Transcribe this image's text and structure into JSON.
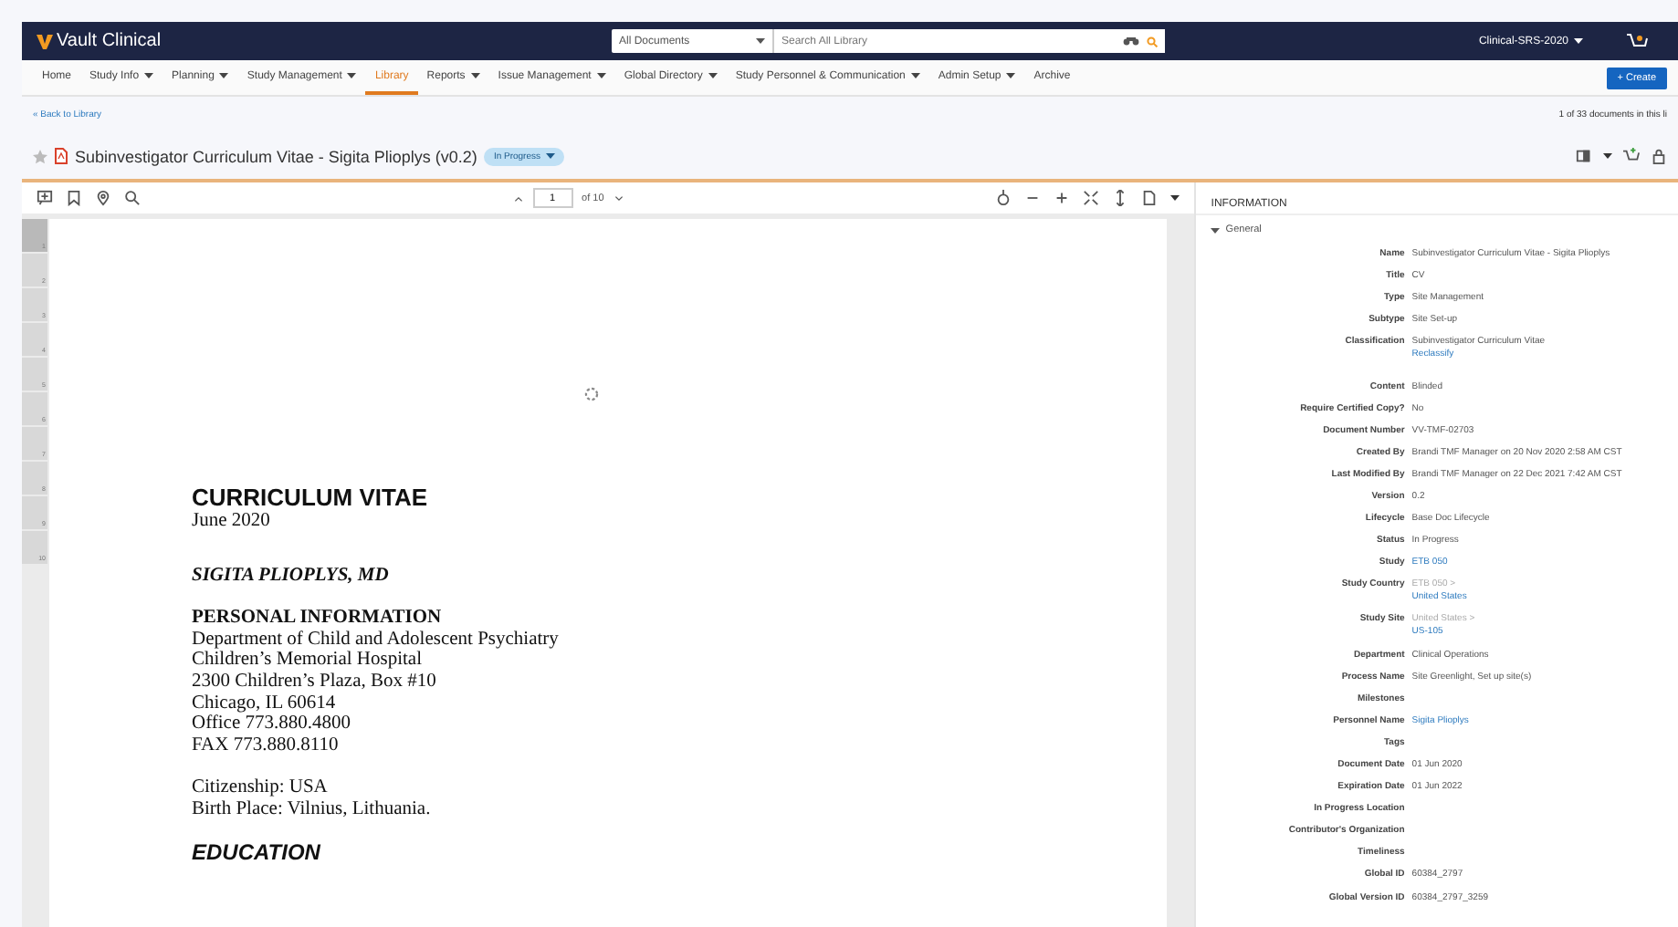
{
  "header": {
    "logo": "Vault Clinical",
    "scope_select": "All Documents",
    "search": {
      "placeholder": "Search All Library"
    },
    "vault_menu": "Clinical-SRS-2020"
  },
  "nav": {
    "items": [
      {
        "label": "Home",
        "has_menu": false,
        "selected": false
      },
      {
        "label": "Study Info",
        "has_menu": true,
        "selected": false
      },
      {
        "label": "Planning",
        "has_menu": true,
        "selected": false
      },
      {
        "label": "Study Management",
        "has_menu": true,
        "selected": false
      },
      {
        "label": "Library",
        "has_menu": false,
        "selected": true
      },
      {
        "label": "Reports",
        "has_menu": true,
        "selected": false
      },
      {
        "label": "Issue Management",
        "has_menu": true,
        "selected": false
      },
      {
        "label": "Global Directory",
        "has_menu": true,
        "selected": false
      },
      {
        "label": "Study Personnel & Communication",
        "has_menu": true,
        "selected": false
      },
      {
        "label": "Admin Setup",
        "has_menu": true,
        "selected": false
      },
      {
        "label": "Archive",
        "has_menu": false,
        "selected": false
      }
    ],
    "create_button": "+ Create"
  },
  "back_link": "« Back to Library",
  "doc_counter": "1 of 33 documents in this li",
  "document": {
    "title": "Subinvestigator Curriculum Vitae - Sigita Plioplys (v0.2)",
    "favorite": false,
    "status": "In Progress"
  },
  "viewer": {
    "page_input": "1",
    "page_total": "of 10",
    "pages": [
      {
        "number": "1",
        "selected": true
      },
      {
        "number": "2",
        "selected": false
      },
      {
        "number": "3",
        "selected": false
      },
      {
        "number": "4",
        "selected": false
      },
      {
        "number": "5",
        "selected": false
      },
      {
        "number": "6",
        "selected": false
      },
      {
        "number": "7",
        "selected": false
      },
      {
        "number": "8",
        "selected": false
      },
      {
        "number": "9",
        "selected": false
      },
      {
        "number": "10",
        "selected": false
      }
    ],
    "content": [
      {
        "kind": "heading",
        "text": "CURRICULUM VITAE"
      },
      {
        "kind": "line",
        "text": "June 2020"
      },
      {
        "kind": "name",
        "text": "SIGITA PLIOPLYS, MD"
      },
      {
        "kind": "section",
        "text": "PERSONAL INFORMATION"
      },
      {
        "kind": "line",
        "text": "Department of Child and Adolescent Psychiatry"
      },
      {
        "kind": "line",
        "text": "Children’s Memorial Hospital"
      },
      {
        "kind": "line",
        "text": "2300 Children’s Plaza, Box #10"
      },
      {
        "kind": "line",
        "text": "Chicago, IL 60614"
      },
      {
        "kind": "line",
        "text": "Office 773.880.4800"
      },
      {
        "kind": "line",
        "text": "FAX 773.880.8110"
      },
      {
        "kind": "para",
        "text": "Citizenship: USA"
      },
      {
        "kind": "line",
        "text": "Birth Place: Vilnius, Lithuania."
      },
      {
        "kind": "heading2",
        "text": "EDUCATION"
      }
    ]
  },
  "info": {
    "title": "INFORMATION",
    "section": {
      "label": "General",
      "expanded": true,
      "groups": [
        [
          {
            "label": "Name",
            "values": [
              {
                "text": "Subinvestigator Curriculum Vitae - Sigita Plioplys",
                "kind": "text"
              }
            ]
          },
          {
            "label": "Title",
            "values": [
              {
                "text": "CV",
                "kind": "text"
              }
            ]
          },
          {
            "label": "Type",
            "values": [
              {
                "text": "Site Management",
                "kind": "text"
              }
            ]
          },
          {
            "label": "Subtype",
            "values": [
              {
                "text": "Site Set-up",
                "kind": "text"
              }
            ]
          },
          {
            "label": "Classification",
            "values": [
              {
                "text": "Subinvestigator Curriculum Vitae",
                "kind": "text"
              },
              {
                "text": "Reclassify",
                "kind": "link"
              }
            ]
          }
        ],
        [
          {
            "label": "Content",
            "values": [
              {
                "text": "Blinded",
                "kind": "text"
              }
            ]
          },
          {
            "label": "Require Certified Copy?",
            "values": [
              {
                "text": "No",
                "kind": "text"
              }
            ]
          },
          {
            "label": "Document Number",
            "values": [
              {
                "text": "VV-TMF-02703",
                "kind": "text"
              }
            ]
          },
          {
            "label": "Created By",
            "values": [
              {
                "text": "Brandi TMF Manager on 20 Nov 2020 2:58 AM CST",
                "kind": "text"
              }
            ]
          },
          {
            "label": "Last Modified By",
            "values": [
              {
                "text": "Brandi TMF Manager on 22 Dec 2021 7:42 AM CST",
                "kind": "text"
              }
            ]
          },
          {
            "label": "Version",
            "values": [
              {
                "text": "0.2",
                "kind": "text"
              }
            ]
          },
          {
            "label": "Lifecycle",
            "values": [
              {
                "text": "Base Doc Lifecycle",
                "kind": "text"
              }
            ]
          },
          {
            "label": "Status",
            "values": [
              {
                "text": "In Progress",
                "kind": "text"
              }
            ]
          },
          {
            "label": "Study",
            "values": [
              {
                "text": "ETB 050",
                "kind": "link"
              }
            ]
          },
          {
            "label": "Study Country",
            "values": [
              {
                "text": "ETB 050 >",
                "kind": "muted"
              },
              {
                "text": "United States",
                "kind": "link"
              }
            ]
          },
          {
            "label": "Study Site",
            "values": [
              {
                "text": "United States >",
                "kind": "muted"
              },
              {
                "text": "US-105",
                "kind": "link"
              }
            ]
          },
          {
            "label": "Department",
            "values": [
              {
                "text": "Clinical Operations",
                "kind": "text"
              }
            ]
          },
          {
            "label": "Process Name",
            "values": [
              {
                "text": "Site Greenlight, Set up site(s)",
                "kind": "text"
              }
            ]
          },
          {
            "label": "Milestones"
          },
          {
            "label": "Personnel Name",
            "values": [
              {
                "text": "Sigita Plioplys",
                "kind": "link"
              }
            ]
          },
          {
            "label": "Tags"
          },
          {
            "label": "Document Date",
            "values": [
              {
                "text": "01 Jun 2020",
                "kind": "text"
              }
            ]
          },
          {
            "label": "Expiration Date",
            "values": [
              {
                "text": "01 Jun 2022",
                "kind": "text"
              }
            ]
          },
          {
            "label": "In Progress Location"
          },
          {
            "label": "Contributor's Organization"
          },
          {
            "label": "Timeliness"
          },
          {
            "label": "Global ID",
            "values": [
              {
                "text": "60384_2797",
                "kind": "text"
              }
            ]
          },
          {
            "label": "Global Version ID",
            "values": [
              {
                "text": "60384_2797_3259",
                "kind": "text"
              }
            ]
          }
        ]
      ]
    }
  }
}
